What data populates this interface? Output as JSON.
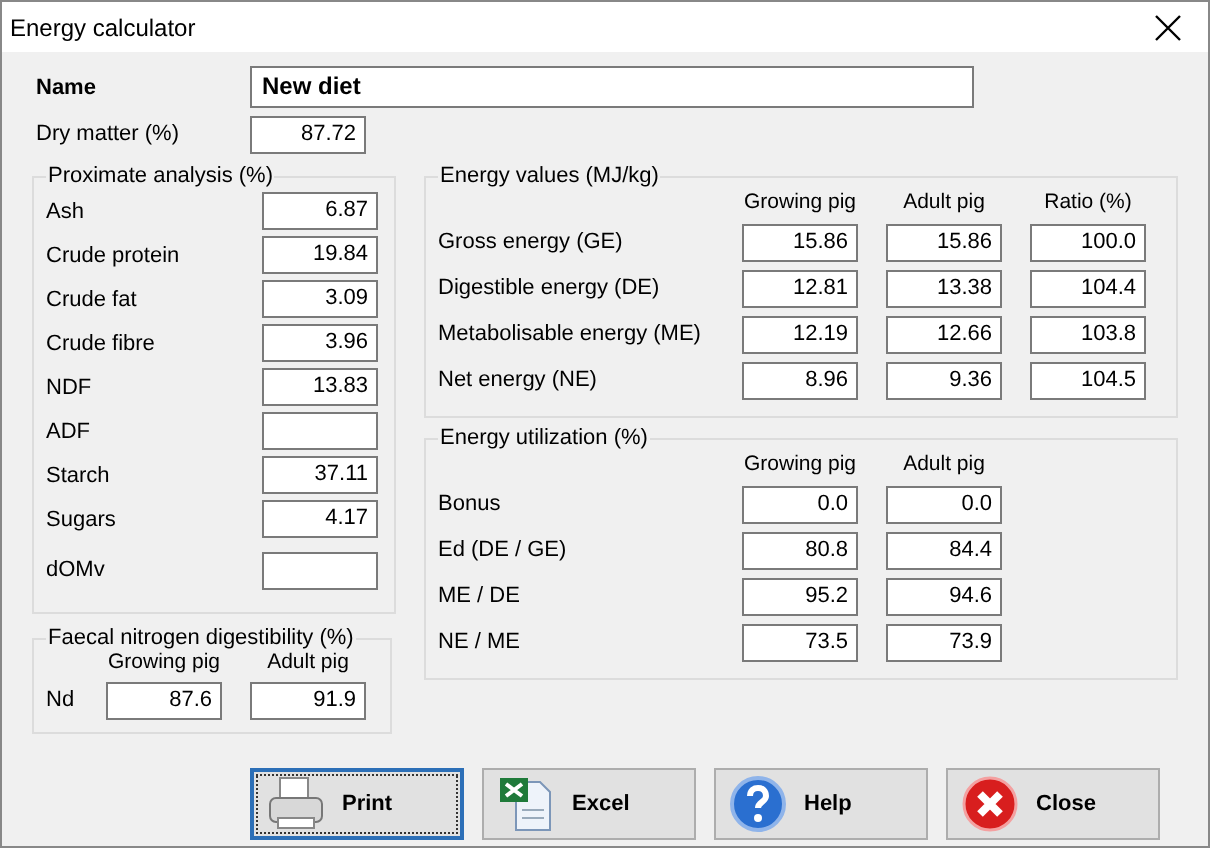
{
  "window": {
    "title": "Energy calculator"
  },
  "name": {
    "label": "Name",
    "value": "New diet"
  },
  "dry_matter": {
    "label": "Dry matter (%)",
    "value": "87.72"
  },
  "proximate_analysis": {
    "title": "Proximate analysis (%)",
    "rows": [
      {
        "label": "Ash",
        "value": "6.87"
      },
      {
        "label": "Crude protein",
        "value": "19.84"
      },
      {
        "label": "Crude fat",
        "value": "3.09"
      },
      {
        "label": "Crude fibre",
        "value": "3.96"
      },
      {
        "label": "NDF",
        "value": "13.83"
      },
      {
        "label": "ADF"
      },
      {
        "label": "Starch",
        "value": "37.11"
      },
      {
        "label": "Sugars",
        "value": "4.17"
      },
      {
        "label": "dOMv"
      }
    ]
  },
  "faecal_nitrogen": {
    "title": "Faecal nitrogen digestibility (%)",
    "columns": [
      "Growing pig",
      "Adult pig"
    ],
    "rows": [
      {
        "label": "Nd",
        "values": [
          "87.6",
          "91.9"
        ]
      }
    ]
  },
  "energy_values": {
    "title": "Energy values (MJ/kg)",
    "columns": [
      "Growing pig",
      "Adult pig",
      "Ratio (%)"
    ],
    "rows": [
      {
        "label": "Gross energy (GE)",
        "values": [
          "15.86",
          "15.86",
          "100.0"
        ]
      },
      {
        "label": "Digestible energy (DE)",
        "values": [
          "12.81",
          "13.38",
          "104.4"
        ]
      },
      {
        "label": "Metabolisable energy (ME)",
        "values": [
          "12.19",
          "12.66",
          "103.8"
        ]
      },
      {
        "label": "Net energy (NE)",
        "values": [
          "8.96",
          "9.36",
          "104.5"
        ]
      }
    ]
  },
  "energy_utilization": {
    "title": "Energy utilization (%)",
    "columns": [
      "Growing pig",
      "Adult pig"
    ],
    "rows": [
      {
        "label": "Bonus",
        "values": [
          "0.0",
          "0.0"
        ]
      },
      {
        "label": "Ed (DE / GE)",
        "values": [
          "80.8",
          "84.4"
        ]
      },
      {
        "label": "ME / DE",
        "values": [
          "95.2",
          "94.6"
        ]
      },
      {
        "label": "NE / ME",
        "values": [
          "73.5",
          "73.9"
        ]
      }
    ]
  },
  "buttons": [
    {
      "label": "Print",
      "kind": "print",
      "focused": true
    },
    {
      "label": "Excel",
      "kind": "excel",
      "focused": false
    },
    {
      "label": "Help",
      "kind": "help",
      "focused": false
    },
    {
      "label": "Close",
      "kind": "close",
      "focused": false
    }
  ]
}
